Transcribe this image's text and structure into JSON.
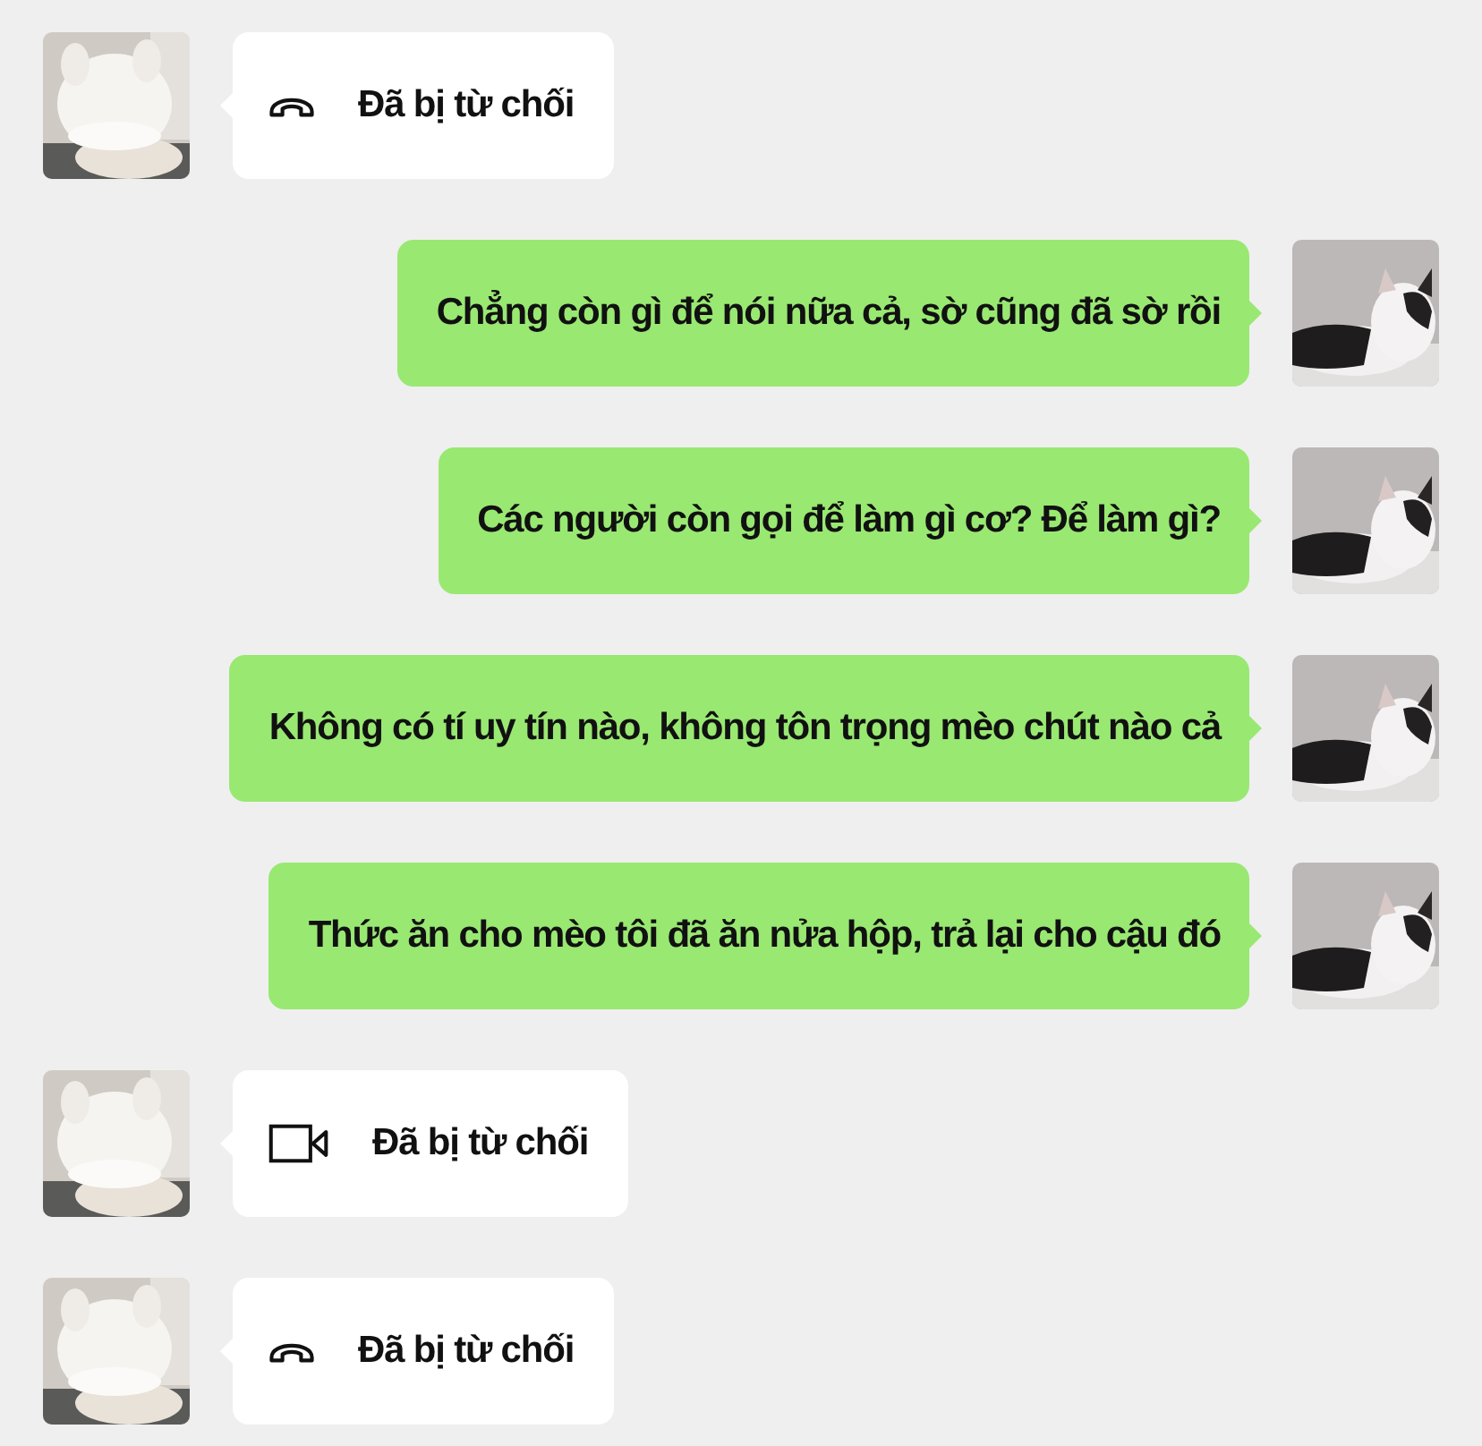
{
  "messages": [
    {
      "kind": "voice_call",
      "text": "Đã bị từ chối"
    },
    {
      "kind": "text",
      "text": "Chẳng còn gì để nói nữa cả, sờ cũng đã sờ rồi"
    },
    {
      "kind": "text",
      "text": "Các người còn gọi để làm gì cơ? Để làm gì?"
    },
    {
      "kind": "text",
      "text": "Không có tí uy tín nào, không tôn trọng mèo chút nào cả"
    },
    {
      "kind": "text",
      "text": "Thức ăn cho mèo tôi đã ăn nửa hộp, trả lại cho cậu đó"
    },
    {
      "kind": "video_call",
      "text": "Đã bị từ chối"
    },
    {
      "kind": "voice_call",
      "text": "Đã bị từ chối"
    }
  ]
}
